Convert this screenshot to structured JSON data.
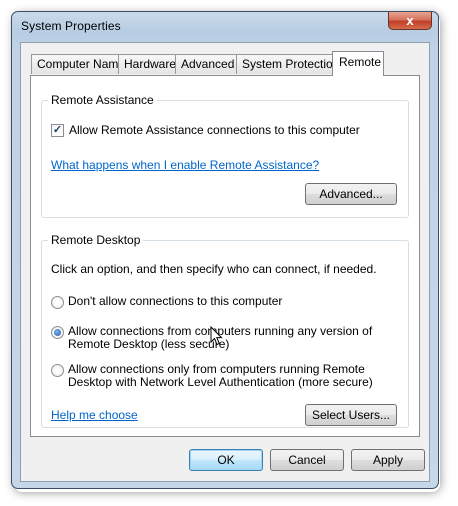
{
  "window": {
    "title": "System Properties",
    "close_glyph": "x"
  },
  "tabs": [
    {
      "label": "Computer Name"
    },
    {
      "label": "Hardware"
    },
    {
      "label": "Advanced"
    },
    {
      "label": "System Protection"
    },
    {
      "label": "Remote"
    }
  ],
  "active_tab": "Remote",
  "remote_assistance": {
    "group_label": "Remote Assistance",
    "checkbox_label": "Allow Remote Assistance connections to this computer",
    "checkbox_checked": true,
    "help_link": "What happens when I enable Remote Assistance?",
    "advanced_button": "Advanced..."
  },
  "remote_desktop": {
    "group_label": "Remote Desktop",
    "instructions": "Click an option, and then specify who can connect, if needed.",
    "options": [
      {
        "line1": "Don't allow connections to this computer",
        "line2": "",
        "selected": false
      },
      {
        "line1": "Allow connections from computers running any version of",
        "line2": "Remote Desktop (less secure)",
        "selected": true
      },
      {
        "line1": "Allow connections only from computers running Remote",
        "line2": "Desktop with Network Level Authentication (more secure)",
        "selected": false
      }
    ],
    "help_link": "Help me choose",
    "select_users_button": "Select Users..."
  },
  "footer": {
    "ok": "OK",
    "cancel": "Cancel",
    "apply": "Apply"
  },
  "icons": {
    "cursor": "arrow-pointer-icon",
    "close": "close-icon"
  }
}
